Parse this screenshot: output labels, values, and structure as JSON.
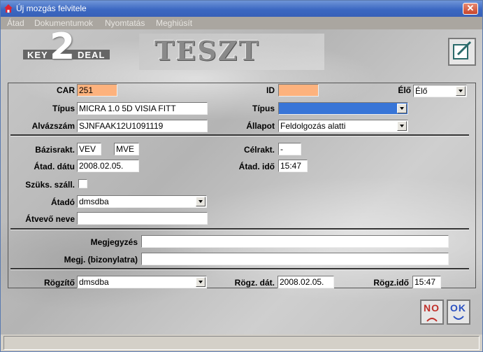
{
  "window": {
    "title": "Új mozgás felvitele",
    "close_label": "✕"
  },
  "menu": [
    "Átad",
    "Dokumentumok",
    "Nyomtatás",
    "Meghiúsít"
  ],
  "banner": {
    "logo_left": "KEY",
    "logo_num": "2",
    "logo_right": "DEAL",
    "env": "TESZT"
  },
  "form": {
    "car_label": "CAR",
    "car": "251",
    "id_label": "ID",
    "id": "",
    "elo_label": "Élő",
    "elo": "Élő",
    "tipus_label": "Típus",
    "tipus": "MICRA 1.0 5D VISIA FITT",
    "tipus2_label": "Típus",
    "tipus2": "",
    "alvaz_label": "Alvázszám",
    "alvaz": "SJNFAAK12U1091119",
    "allapot_label": "Állapot",
    "allapot": "Feldolgozás alatti",
    "bazis_label": "Bázisrakt.",
    "bazis1": "VEV",
    "bazis2": "MVE",
    "cel_label": "Célrakt.",
    "cel": "-",
    "atad_datum_label": "Átad. dátu",
    "atad_datum": "2008.02.05.",
    "atad_ido_label": "Átad. idő",
    "atad_ido": "15:47",
    "szuks_label": "Szüks. száll.",
    "atado_label": "Átadó",
    "atado": "dmsdba",
    "atvevo_label": "Átvevő neve",
    "atvevo": "",
    "megj_label": "Megjegyzés",
    "megj": "",
    "megj_biz_label": "Megj. (bizonylatra)",
    "megj_biz": "",
    "rogzito_label": "Rögzítő",
    "rogzito": "dmsdba",
    "rogz_dat_label": "Rögz. dát.",
    "rogz_dat": "2008.02.05.",
    "rogz_ido_label": "Rögz.idő",
    "rogz_ido": "15:47"
  },
  "buttons": {
    "no": "NO",
    "ok": "OK"
  },
  "colors": {
    "title": "#3c68c2",
    "highlight": "#fdb27d",
    "selection": "#3875d7"
  }
}
